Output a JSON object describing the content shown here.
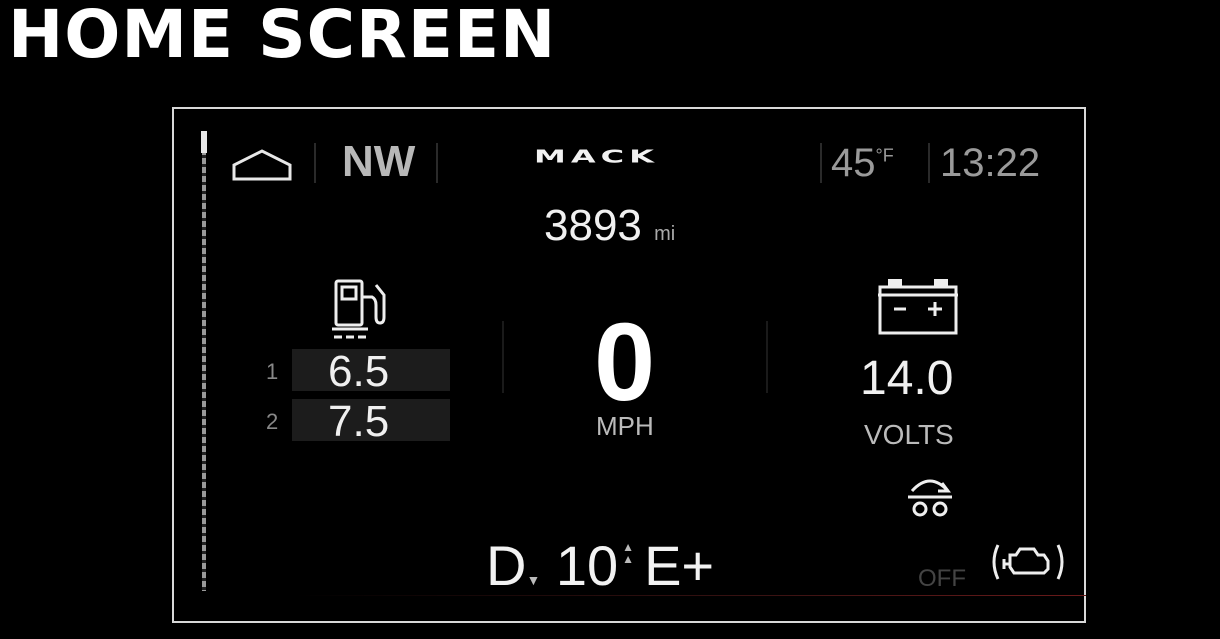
{
  "page_title": "HOME SCREEN",
  "status_bar": {
    "home_icon": "home-icon",
    "heading": "NW",
    "brand": "MACK",
    "temperature": "45",
    "temperature_unit": "°F",
    "time": "13:22"
  },
  "odometer": {
    "value": "3893",
    "unit": "mi"
  },
  "fuel": {
    "icon": "fuel-pump-icon",
    "rows": [
      {
        "index": "1",
        "value": "6.5"
      },
      {
        "index": "2",
        "value": "7.5"
      }
    ]
  },
  "speed": {
    "value": "0",
    "unit": "MPH"
  },
  "battery": {
    "icon": "battery-icon",
    "value": "14.0",
    "unit": "VOLTS"
  },
  "retarder": {
    "icon": "engine-brake-icon"
  },
  "transmission": {
    "mode": "D",
    "gear": "10",
    "setting": "E+"
  },
  "engine_status": {
    "label": "OFF",
    "icon": "check-engine-icon"
  },
  "colors": {
    "background": "#000000",
    "text": "#f0f0f0",
    "dim": "#9a9a9a",
    "frame": "#d8d8d8"
  }
}
